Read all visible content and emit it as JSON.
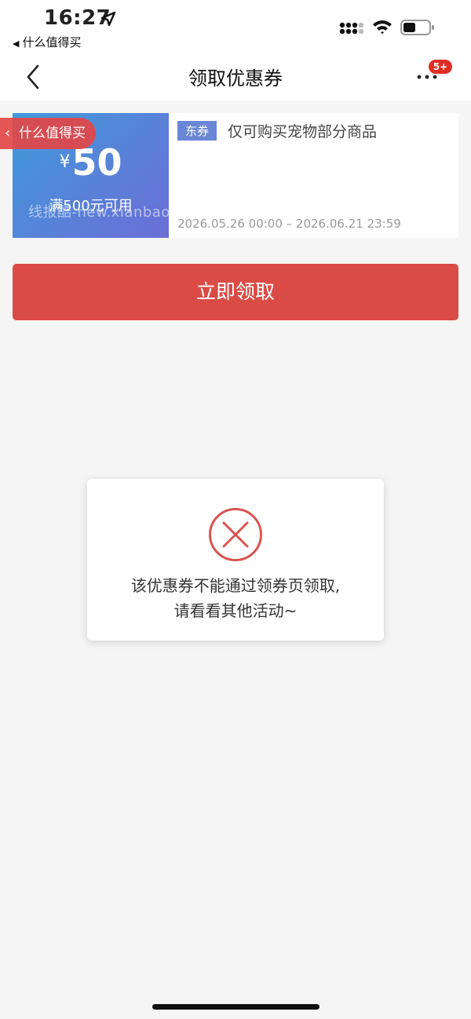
{
  "status_bar": {
    "time": "16:27",
    "back_app": "什么值得买",
    "back_arrow": "◀"
  },
  "nav": {
    "title": "领取优惠券",
    "more_icon": "more-dots-icon",
    "badge": "5+"
  },
  "coupon": {
    "currency": "¥",
    "amount": "50",
    "condition": "满500元可用",
    "tag": "东券",
    "description": "仅可购买宠物部分商品",
    "validity": "2026.05.26 00:00 – 2026.06.21 23:59",
    "gradient_colors": [
      "#3e9bdb",
      "#6b6ed6"
    ]
  },
  "float_tag": {
    "label": "什么值得买"
  },
  "watermark": "线报酷-new.xianbao.fun",
  "claim_button": {
    "label": "立即领取",
    "color": "#db4b45"
  },
  "dialog": {
    "icon": "error-circle-x-icon",
    "message_line1": "该优惠券不能通过领券页领取,",
    "message_line2": "请看看其他活动~",
    "icon_color": "#d9544f"
  }
}
